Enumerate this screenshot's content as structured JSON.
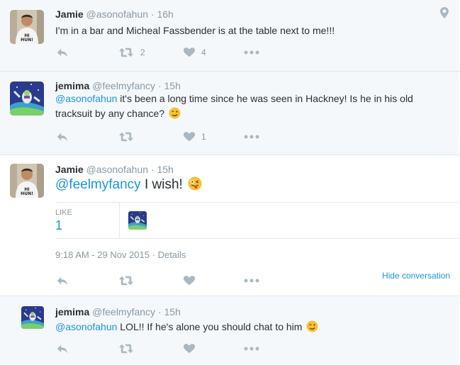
{
  "tweets": [
    {
      "name": "Jamie",
      "handle": "@asonofahun",
      "dot": "·",
      "time": "16h",
      "text": "I'm in a bar and Micheal Fassbender is at the table next to me!!!",
      "retweets": "2",
      "likes": "4"
    },
    {
      "name": "jemima",
      "handle": "@feelmyfancy",
      "dot": "·",
      "time": "15h",
      "mention": "@asonofahun",
      "text": " it's been a long time since he was seen in Hackney! Is he in his old tracksuit by any chance?",
      "retweets": "",
      "likes": "1"
    },
    {
      "name": "Jamie",
      "handle": "@asonofahun",
      "dot": "·",
      "time": "15h",
      "mention": "@feelmyfancy",
      "text": " I wish!",
      "likes_label": "LIKE",
      "likes_count": "1",
      "timestamp": "9:18 AM - 29 Nov 2015",
      "details": "Details",
      "hide_conversation": "Hide conversation"
    },
    {
      "name": "jemima",
      "handle": "@feelmyfancy",
      "dot": "·",
      "time": "15h",
      "mention": "@asonofahun",
      "text": " LOL!! If he's alone you should chat to him"
    }
  ],
  "colors": {
    "link": "#1b95e0",
    "muted": "#8899a6",
    "icon": "#aab8c2",
    "background_grey": "#f5f8fa"
  },
  "icons": [
    "reply-icon",
    "retweet-icon",
    "like-icon",
    "more-icon",
    "location-icon",
    "wink-emoji",
    "tongue-emoji"
  ]
}
